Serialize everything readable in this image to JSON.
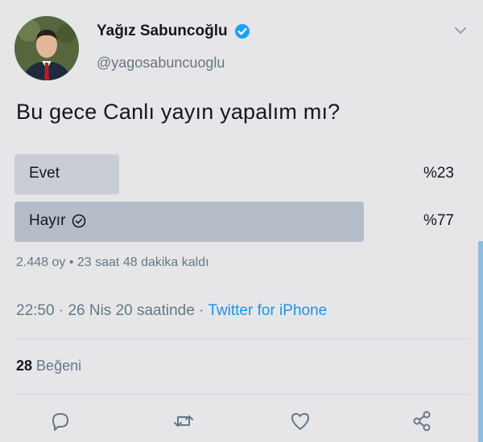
{
  "author": {
    "display_name": "Yağız Sabuncoğlu",
    "handle": "@yagosabuncuoglu",
    "verified": true
  },
  "tweet": {
    "text": "Bu gece Canlı yayın yapalım mı?"
  },
  "poll": {
    "options": [
      {
        "label": "Evet",
        "percent_label": "%23",
        "share": 0.23,
        "winner": false
      },
      {
        "label": "Hayır",
        "percent_label": "%77",
        "share": 0.77,
        "winner": true
      }
    ],
    "votes_text": "2.448 oy",
    "separator": " • ",
    "time_left": "23 saat 48 dakika kaldı"
  },
  "meta": {
    "time": "22:50",
    "sep1": " · ",
    "date": "26 Nis 20 saatinde",
    "sep2": " · ",
    "source": "Twitter for iPhone"
  },
  "likes": {
    "count": "28",
    "label": "Beğeni"
  },
  "actions": [
    "reply-icon",
    "retweet-icon",
    "like-icon",
    "share-icon"
  ],
  "colors": {
    "link": "#1b95e0",
    "verified": "#1da1f2",
    "winner_bar": "#b5bec8",
    "loser_bar": "#c9ced4"
  }
}
